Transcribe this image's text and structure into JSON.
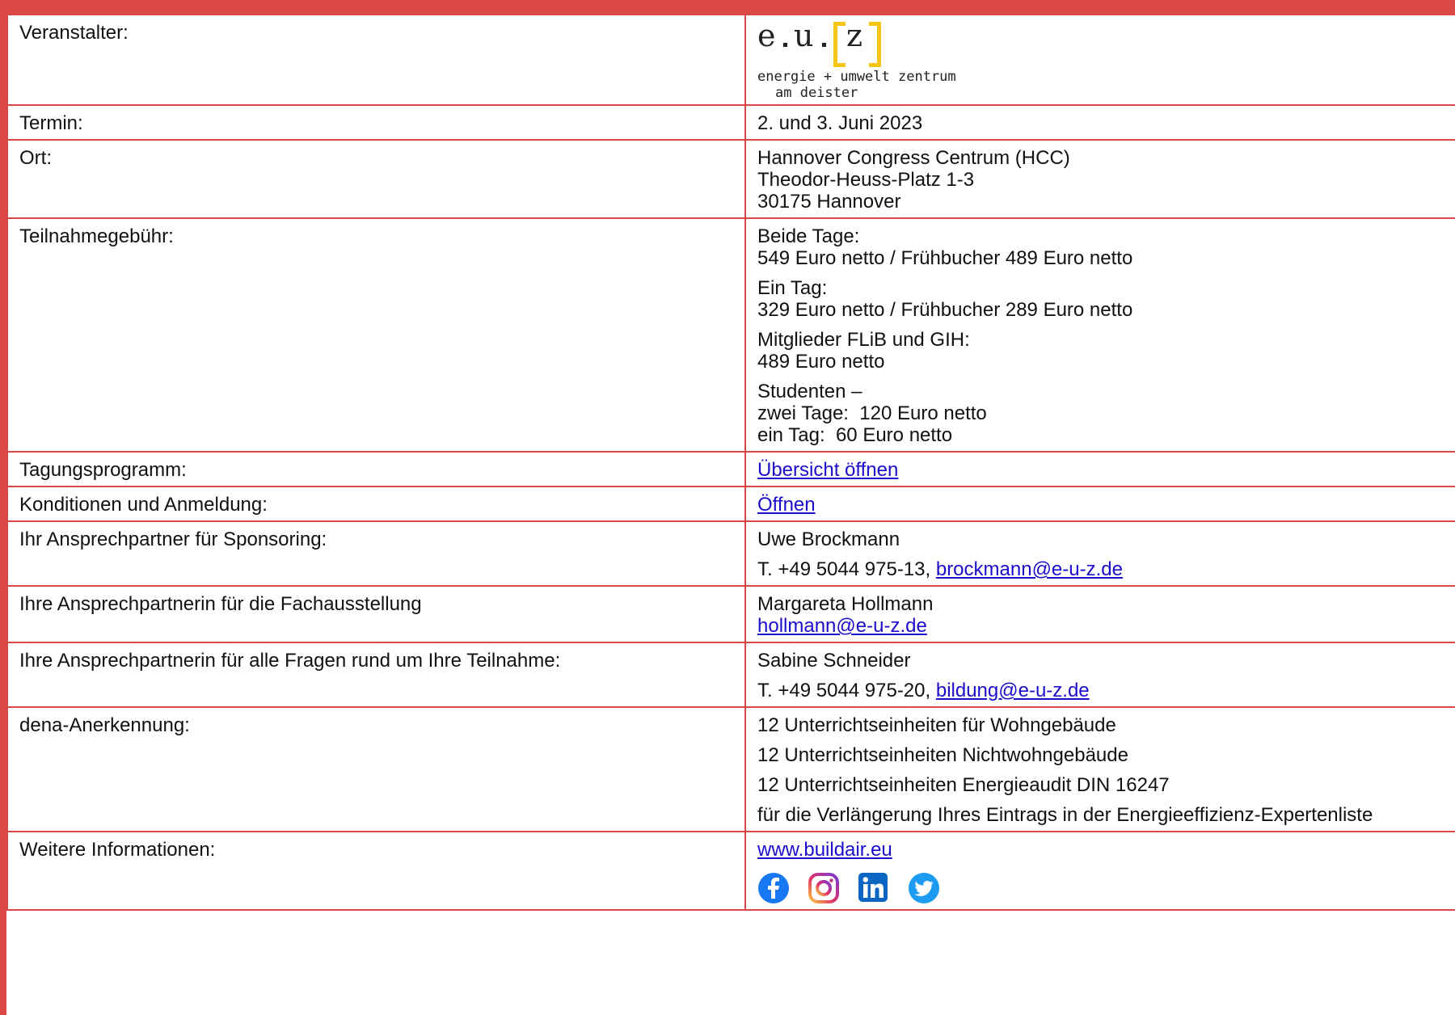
{
  "colors": {
    "border": "#d94845",
    "link": "#1a0dcc",
    "logo_accent": "#f5c518"
  },
  "logo": {
    "e": "e",
    "u": "u",
    "z": "z",
    "line1": "energie + umwelt zentrum",
    "line2": "am deister"
  },
  "rows": {
    "veranstalter": {
      "label": "Veranstalter:"
    },
    "termin": {
      "label": "Termin:",
      "value": "2. und 3. Juni 2023"
    },
    "ort": {
      "label": "Ort:",
      "lines": [
        "Hannover Congress Centrum (HCC)",
        "Theodor-Heuss-Platz 1-3",
        "30175 Hannover"
      ]
    },
    "gebuehr": {
      "label": "Teilnahmegebühr:",
      "groups": [
        [
          "Beide Tage:",
          "549 Euro netto / Frühbucher 489 Euro netto"
        ],
        [
          "Ein Tag:",
          "329 Euro netto / Frühbucher 289 Euro netto"
        ],
        [
          "Mitglieder FLiB und GIH:",
          "489 Euro netto"
        ],
        [
          "Studenten –",
          "zwei Tage:  120 Euro netto",
          "ein Tag:  60 Euro netto"
        ]
      ]
    },
    "programm": {
      "label": "Tagungsprogramm:",
      "link": "Übersicht öffnen"
    },
    "anmeldung": {
      "label": "Konditionen und Anmeldung:",
      "link": "Öffnen"
    },
    "sponsoring": {
      "label": "Ihr Ansprechpartner für Sponsoring:",
      "name": "Uwe Brockmann",
      "phone": "T. +49 5044 975-13, ",
      "email": "brockmann@e-u-z.de"
    },
    "fachausstellung": {
      "label": "Ihre Ansprechpartnerin für die Fachausstellung",
      "name": "Margareta Hollmann",
      "email": "hollmann@e-u-z.de"
    },
    "teilnahme": {
      "label": "Ihre Ansprechpartnerin für alle Fragen rund um Ihre Teilnahme:",
      "name": "Sabine Schneider",
      "phone": "T. +49 5044 975-20, ",
      "email": "bildung@e-u-z.de"
    },
    "dena": {
      "label": "dena-Anerkennung:",
      "lines": [
        "12 Unterrichtseinheiten für Wohngebäude",
        "12 Unterrichtseinheiten Nichtwohngebäude",
        "12 Unterrichtseinheiten Energieaudit DIN 16247",
        "für die Verlängerung Ihres Eintrags in der Energieeffizienz-Expertenliste"
      ]
    },
    "weitere": {
      "label": "Weitere Informationen:",
      "link": "www.buildair.eu",
      "social": [
        "facebook-icon",
        "instagram-icon",
        "linkedin-icon",
        "twitter-icon"
      ]
    }
  }
}
